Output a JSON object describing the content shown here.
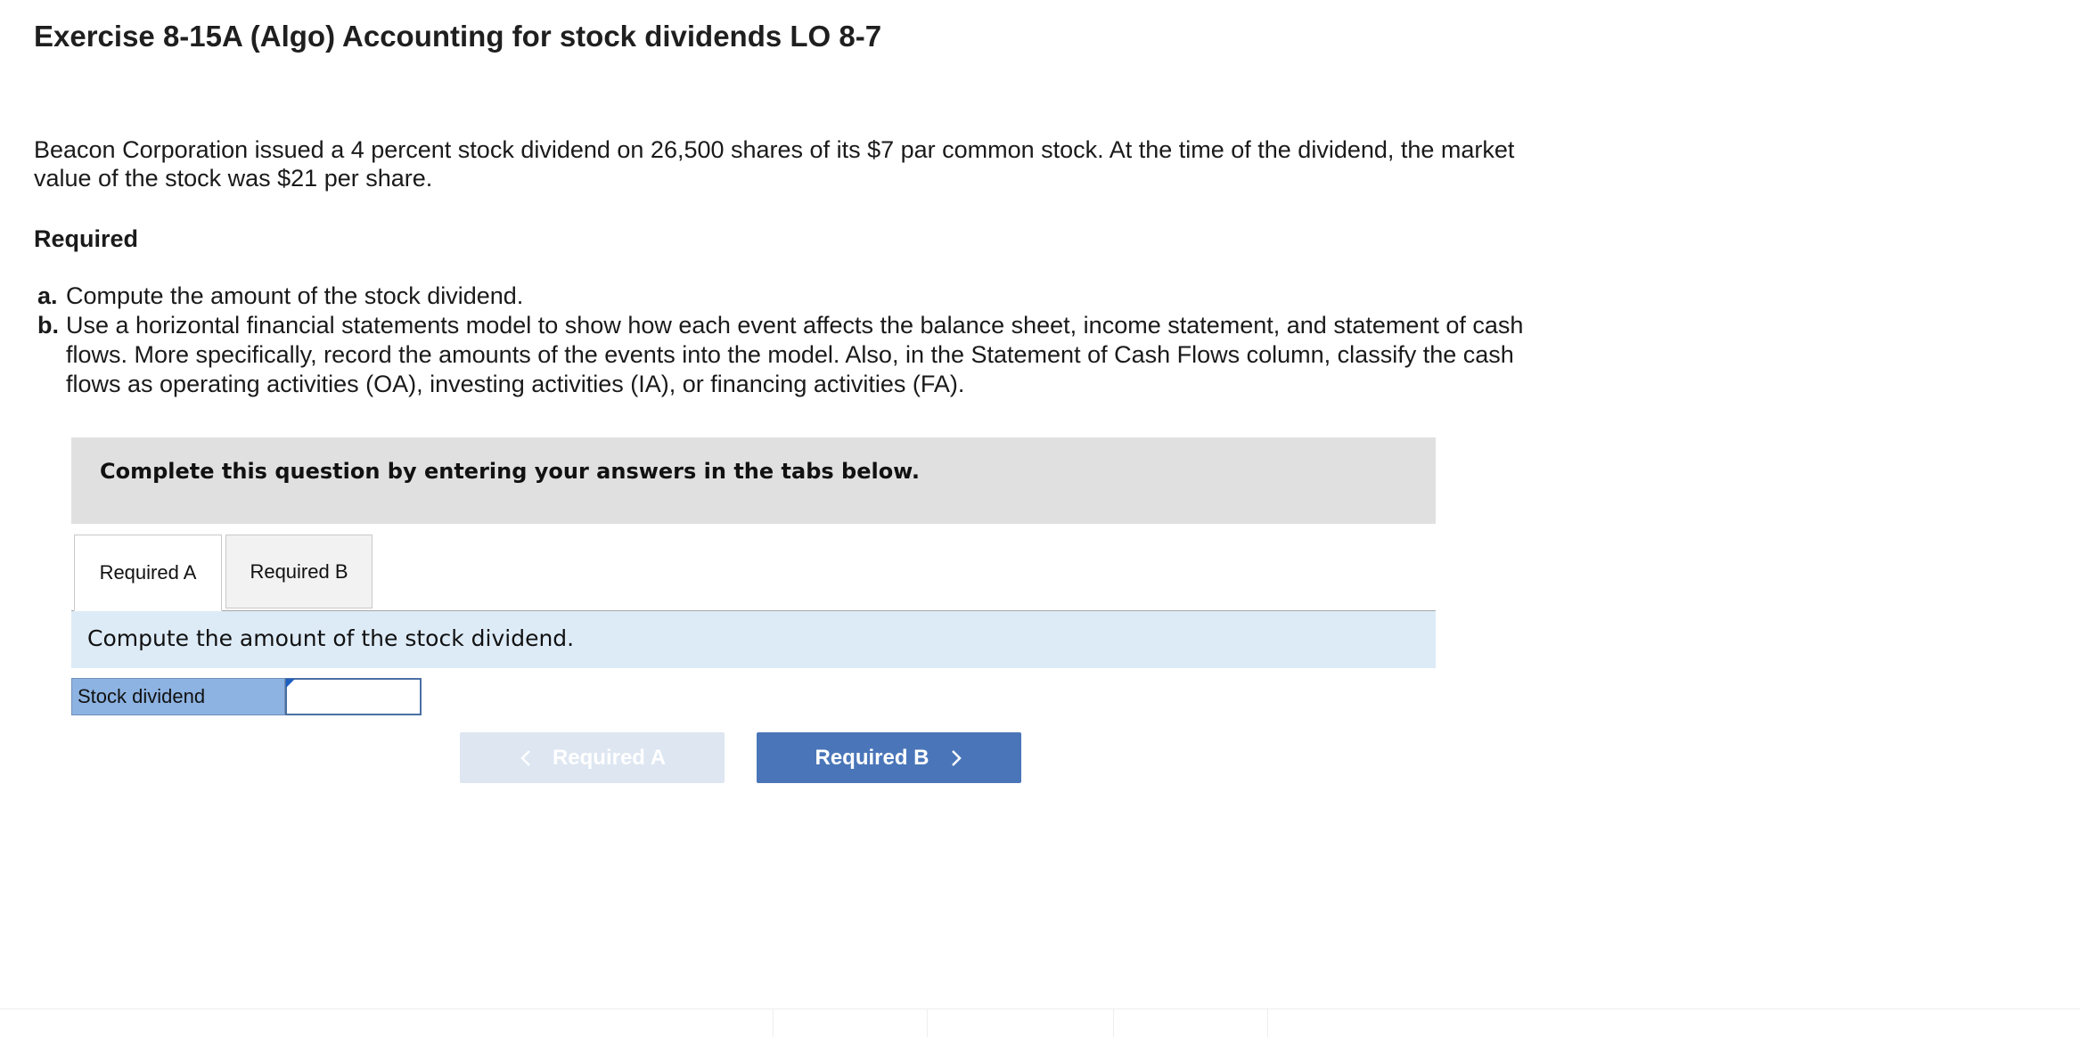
{
  "header": {
    "title": "Exercise 8-15A (Algo) Accounting for stock dividends LO 8-7"
  },
  "problem": {
    "intro": "Beacon Corporation issued a 4 percent stock dividend on 26,500 shares of its $7 par common stock. At the time of the dividend, the market value of the stock was $21 per share.",
    "required_heading": "Required",
    "items": [
      {
        "letter": "a.",
        "text": "Compute the amount of the stock dividend."
      },
      {
        "letter": "b.",
        "text": "Use a horizontal financial statements model to show how each event affects the balance sheet, income statement, and statement of cash flows. More specifically, record the amounts of the events into the model. Also, in the Statement of Cash Flows column, classify the cash flows as operating activities (OA), investing activities (IA), or financing activities (FA)."
      }
    ]
  },
  "instruction": {
    "text": "Complete this question by entering your answers in the tabs below."
  },
  "tabs": [
    {
      "label": "Required A",
      "active": true
    },
    {
      "label": "Required B",
      "active": false
    }
  ],
  "tab_content": {
    "prompt": "Compute the amount of the stock dividend.",
    "answer_label": "Stock dividend",
    "answer_value": ""
  },
  "navigation": {
    "prev_label": "Required A",
    "prev_enabled": false,
    "next_label": "Required B",
    "next_enabled": true
  },
  "colors": {
    "instruction_bg": "#e0e0e0",
    "prompt_bg": "#ddebf7",
    "answer_label_bg": "#8db3e2",
    "next_button": "#4a76b9",
    "prev_button_disabled": "#dde6f1"
  }
}
